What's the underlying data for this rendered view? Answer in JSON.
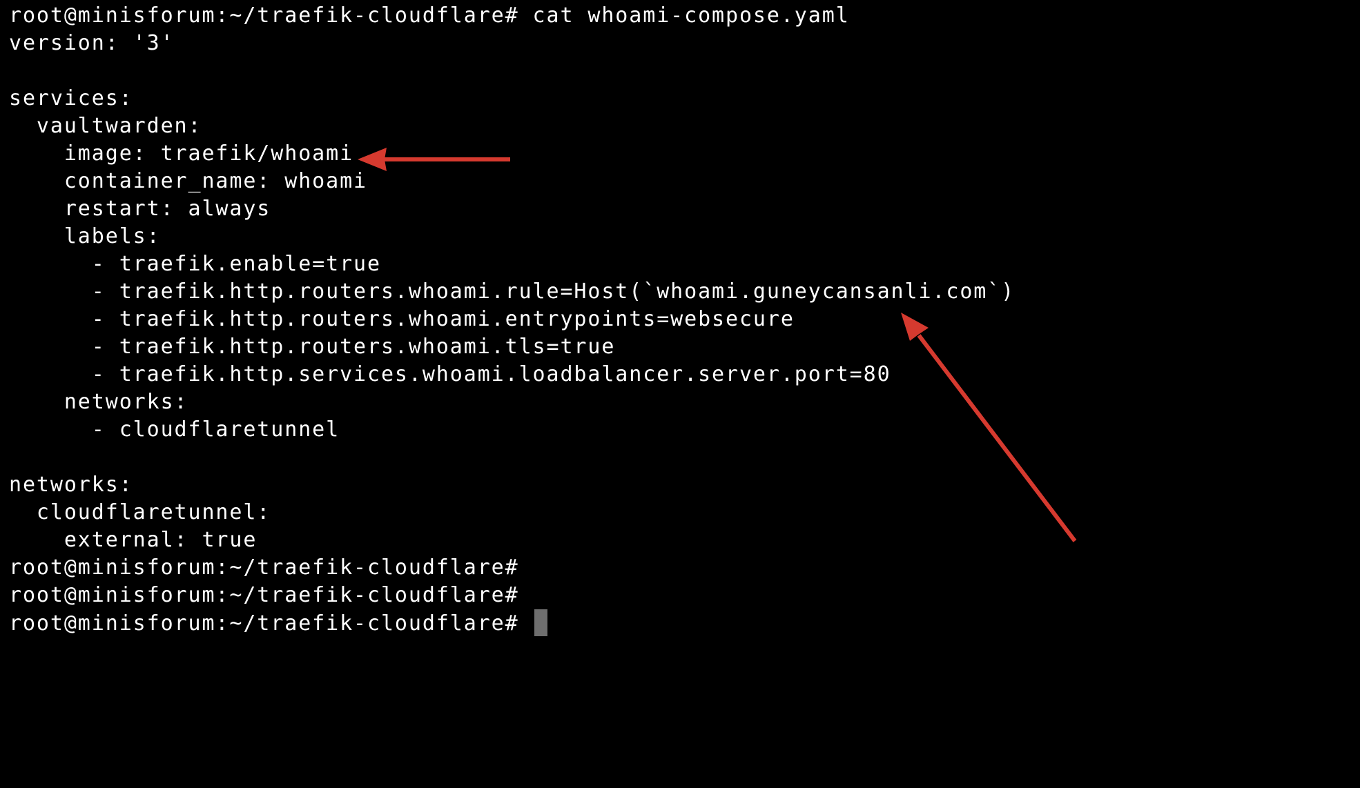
{
  "terminal": {
    "background_color": "#000000",
    "text_color": "#ffffff",
    "cursor_color": "#6e6e6e",
    "lines": [
      {
        "text": "root@minisforum:~/traefik-cloudflare# cat whoami-compose.yaml"
      },
      {
        "text": "version: '3'"
      },
      {
        "text": ""
      },
      {
        "text": "services:"
      },
      {
        "text": "  vaultwarden:"
      },
      {
        "text": "    image: traefik/whoami"
      },
      {
        "text": "    container_name: whoami"
      },
      {
        "text": "    restart: always"
      },
      {
        "text": "    labels:"
      },
      {
        "text": "      - traefik.enable=true"
      },
      {
        "text": "      - traefik.http.routers.whoami.rule=Host(`whoami.guneycansanli.com`)"
      },
      {
        "text": "      - traefik.http.routers.whoami.entrypoints=websecure"
      },
      {
        "text": "      - traefik.http.routers.whoami.tls=true"
      },
      {
        "text": "      - traefik.http.services.whoami.loadbalancer.server.port=80"
      },
      {
        "text": "    networks:"
      },
      {
        "text": "      - cloudflaretunnel"
      },
      {
        "text": ""
      },
      {
        "text": "networks:"
      },
      {
        "text": "  cloudflaretunnel:"
      },
      {
        "text": "    external: true"
      },
      {
        "text": "root@minisforum:~/traefik-cloudflare#"
      },
      {
        "text": "root@minisforum:~/traefik-cloudflare#"
      },
      {
        "text": "root@minisforum:~/traefik-cloudflare# "
      }
    ]
  },
  "annotations": {
    "arrow_color": "#d63a2f",
    "arrows": [
      {
        "points_to": "image: traefik/whoami"
      },
      {
        "points_to": "whoami.guneycansanli.com"
      }
    ]
  }
}
